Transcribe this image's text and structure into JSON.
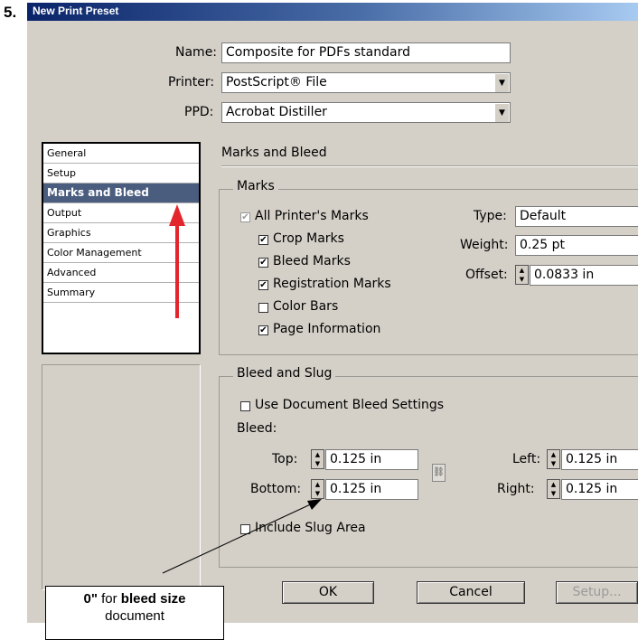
{
  "step_number": "5.",
  "dialog_title": "New Print Preset",
  "top_fields": {
    "name_label": "Name:",
    "name_value": "Composite for PDFs standard",
    "printer_label": "Printer:",
    "printer_value": "PostScript® File",
    "ppd_label": "PPD:",
    "ppd_value": "Acrobat Distiller"
  },
  "panel_list": [
    {
      "label": "General",
      "selected": false
    },
    {
      "label": "Setup",
      "selected": false
    },
    {
      "label": "Marks and Bleed",
      "selected": true
    },
    {
      "label": "Output",
      "selected": false
    },
    {
      "label": "Graphics",
      "selected": false
    },
    {
      "label": "Color Management",
      "selected": false
    },
    {
      "label": "Advanced",
      "selected": false
    },
    {
      "label": "Summary",
      "selected": false
    }
  ],
  "section_title": "Marks and Bleed",
  "marks": {
    "group_label": "Marks",
    "all_printers_marks": {
      "label": "All Printer's Marks",
      "checked": true,
      "disabled": true
    },
    "crop_marks": {
      "label": "Crop Marks",
      "checked": true
    },
    "bleed_marks": {
      "label": "Bleed Marks",
      "checked": true
    },
    "registration_marks": {
      "label": "Registration Marks",
      "checked": true
    },
    "color_bars": {
      "label": "Color Bars",
      "checked": false
    },
    "page_information": {
      "label": "Page Information",
      "checked": true
    },
    "type_label": "Type:",
    "type_value": "Default",
    "weight_label": "Weight:",
    "weight_value": "0.25 pt",
    "offset_label": "Offset:",
    "offset_value": "0.0833 in"
  },
  "bleed_slug": {
    "group_label": "Bleed and Slug",
    "use_document_bleed": {
      "label": "Use Document Bleed Settings",
      "checked": false
    },
    "bleed_label": "Bleed:",
    "top_label": "Top:",
    "top_value": "0.125 in",
    "bottom_label": "Bottom:",
    "bottom_value": "0.125 in",
    "left_label": "Left:",
    "left_value": "0.125 in",
    "right_label": "Right:",
    "right_value": "0.125 in",
    "include_slug": {
      "label": "Include Slug Area",
      "checked": false
    }
  },
  "buttons": {
    "ok": "OK",
    "cancel": "Cancel",
    "setup": "Setup..."
  },
  "callout": {
    "line1_bold_a": "0\"",
    "line1_mid": " for ",
    "line1_bold_b": "bleed size",
    "line2": "document"
  },
  "colors": {
    "selection": "#4a5d7e",
    "arrow_red": "#e3262d"
  },
  "check_glyph": "✔"
}
